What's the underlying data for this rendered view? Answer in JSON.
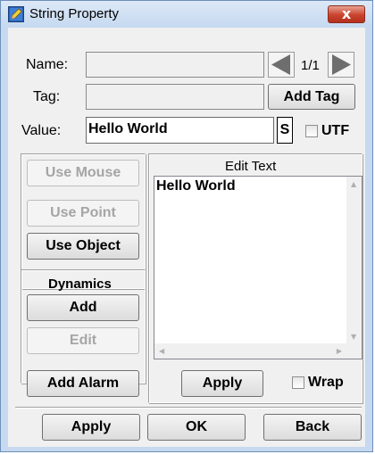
{
  "window": {
    "title": "String Property",
    "close_label": "x",
    "app_icon": "pencil-icon"
  },
  "fields": {
    "name_label": "Name:",
    "name_value": "",
    "tag_label": "Tag:",
    "tag_value": "",
    "value_label": "Value:",
    "value_text": "Hello World",
    "s_button_label": "S",
    "utf_label": "UTF",
    "utf_checked": false
  },
  "pager": {
    "text": "1/1",
    "prev_icon": "triangle-left-icon",
    "next_icon": "triangle-right-icon"
  },
  "buttons": {
    "add_tag": "Add Tag",
    "use_mouse": "Use Mouse",
    "use_point": "Use Point",
    "use_object": "Use Object",
    "add_alarm": "Add Alarm"
  },
  "dynamics": {
    "title": "Dynamics",
    "add": "Add",
    "edit": "Edit"
  },
  "edit_text": {
    "title": "Edit Text",
    "content": "Hello World",
    "apply": "Apply",
    "wrap_label": "Wrap",
    "wrap_checked": false
  },
  "footer": {
    "apply": "Apply",
    "ok": "OK",
    "back": "Back"
  },
  "colors": {
    "titlebar": "#c6d9f0",
    "close_button": "#c9432d",
    "dialog_bg": "#f0f0f0"
  }
}
